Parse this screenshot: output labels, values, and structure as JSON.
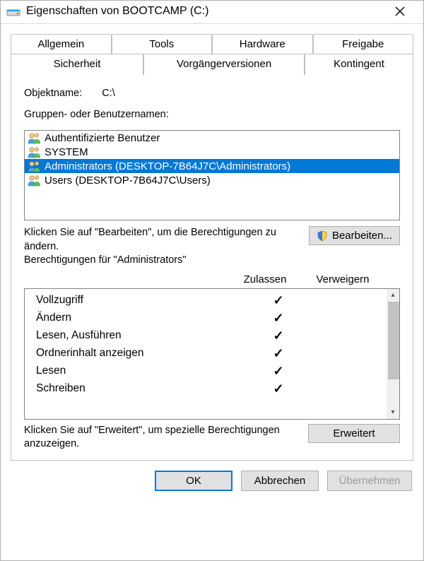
{
  "title": "Eigenschaften von BOOTCAMP (C:)",
  "tabs": {
    "row1": [
      "Allgemein",
      "Tools",
      "Hardware",
      "Freigabe"
    ],
    "row2": [
      "Sicherheit",
      "Vorgängerversionen",
      "Kontingent"
    ],
    "active": "Sicherheit"
  },
  "object": {
    "label": "Objektname:",
    "value": "C:\\"
  },
  "groups_label": "Gruppen- oder Benutzernamen:",
  "users": [
    {
      "name": "Authentifizierte Benutzer",
      "selected": false
    },
    {
      "name": "SYSTEM",
      "selected": false
    },
    {
      "name": "Administrators (DESKTOP-7B64J7C\\Administrators)",
      "selected": true
    },
    {
      "name": "Users (DESKTOP-7B64J7C\\Users)",
      "selected": false
    }
  ],
  "edit_hint": "Klicken Sie auf \"Bearbeiten\", um die Berechtigungen zu ändern.",
  "edit_btn": "Bearbeiten...",
  "perm_for": "Berechtigungen für \"Administrators\"",
  "columns": {
    "allow": "Zulassen",
    "deny": "Verweigern"
  },
  "permissions": [
    {
      "name": "Vollzugriff",
      "allow": true,
      "deny": false
    },
    {
      "name": "Ändern",
      "allow": true,
      "deny": false
    },
    {
      "name": "Lesen, Ausführen",
      "allow": true,
      "deny": false
    },
    {
      "name": "Ordnerinhalt anzeigen",
      "allow": true,
      "deny": false
    },
    {
      "name": "Lesen",
      "allow": true,
      "deny": false
    },
    {
      "name": "Schreiben",
      "allow": true,
      "deny": false
    }
  ],
  "advanced_hint": "Klicken Sie auf \"Erweitert\", um spezielle Berechtigungen anzuzeigen.",
  "advanced_btn": "Erweitert",
  "buttons": {
    "ok": "OK",
    "cancel": "Abbrechen",
    "apply": "Übernehmen"
  }
}
